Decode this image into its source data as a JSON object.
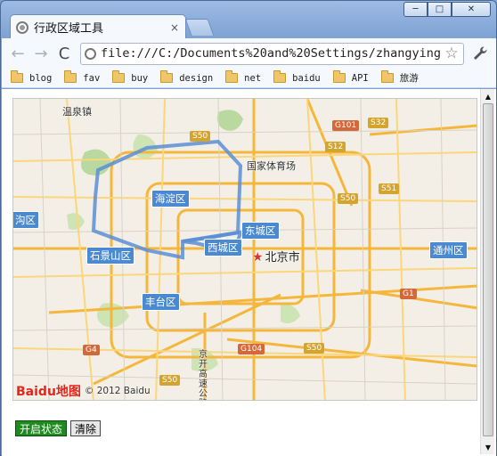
{
  "window": {
    "controls": [
      "─",
      "□",
      "✕"
    ]
  },
  "tab": {
    "title": "行政区域工具",
    "close": "×"
  },
  "toolbar": {
    "back": "←",
    "forward": "→",
    "reload": "C",
    "url": "file:///C:/Documents%20and%20Settings/zhangying",
    "star": "☆",
    "wrench": "🔧"
  },
  "bookmarks": [
    "blog",
    "fav",
    "buy",
    "design",
    "net",
    "baidu",
    "API",
    "旅游"
  ],
  "map": {
    "districts": [
      "海淀区",
      "东城区",
      "西城区",
      "石景山区",
      "丰台区",
      "通州区",
      "沟区"
    ],
    "places": [
      "温泉镇",
      "国家体育场",
      "京开高速公路"
    ],
    "capital": "北京市",
    "roads": [
      "S50",
      "G101",
      "S32",
      "S12",
      "S50",
      "S51",
      "G1",
      "G4",
      "G104",
      "S50",
      "S50"
    ],
    "logo": "Baidu地图",
    "copyright": "© 2012 Baidu"
  },
  "buttons": {
    "start": "开启状态",
    "clear": "清除"
  }
}
